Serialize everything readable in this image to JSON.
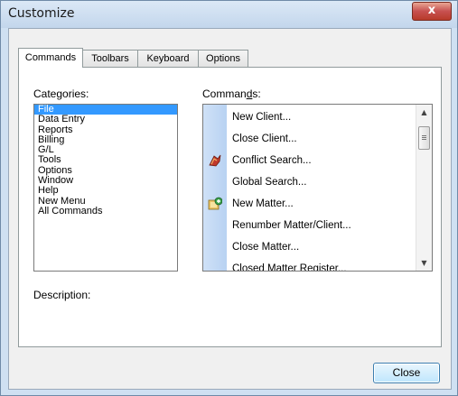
{
  "window": {
    "title": "Customize",
    "close_glyph": "x"
  },
  "tabs": [
    {
      "label": "Commands",
      "active": true
    },
    {
      "label": "Toolbars",
      "active": false
    },
    {
      "label": "Keyboard",
      "active": false
    },
    {
      "label": "Options",
      "active": false
    }
  ],
  "categories": {
    "label_before": "Cate",
    "label_accel": "g",
    "label_after": "ories:",
    "items": [
      "File",
      "Data Entry",
      "Reports",
      "Billing",
      "G/L",
      "Tools",
      "Options",
      "Window",
      "Help",
      "New Menu",
      "All Commands"
    ],
    "selected": "File"
  },
  "commands": {
    "label_before": "Comman",
    "label_accel": "d",
    "label_after": "s:",
    "items": [
      {
        "label": "New Client...",
        "icon": ""
      },
      {
        "label": "Close Client...",
        "icon": ""
      },
      {
        "label": "Conflict Search...",
        "icon": "conflict-search-icon"
      },
      {
        "label": "Global Search...",
        "icon": ""
      },
      {
        "label": "New Matter...",
        "icon": "new-matter-icon"
      },
      {
        "label": "Renumber Matter/Client...",
        "icon": ""
      },
      {
        "label": "Close Matter...",
        "icon": ""
      },
      {
        "label": "Closed Matter Register...",
        "icon": ""
      }
    ]
  },
  "description": {
    "label": "Description:"
  },
  "buttons": {
    "close": "Close"
  },
  "colors": {
    "selection": "#3399ff",
    "title_close": "#c75050"
  }
}
